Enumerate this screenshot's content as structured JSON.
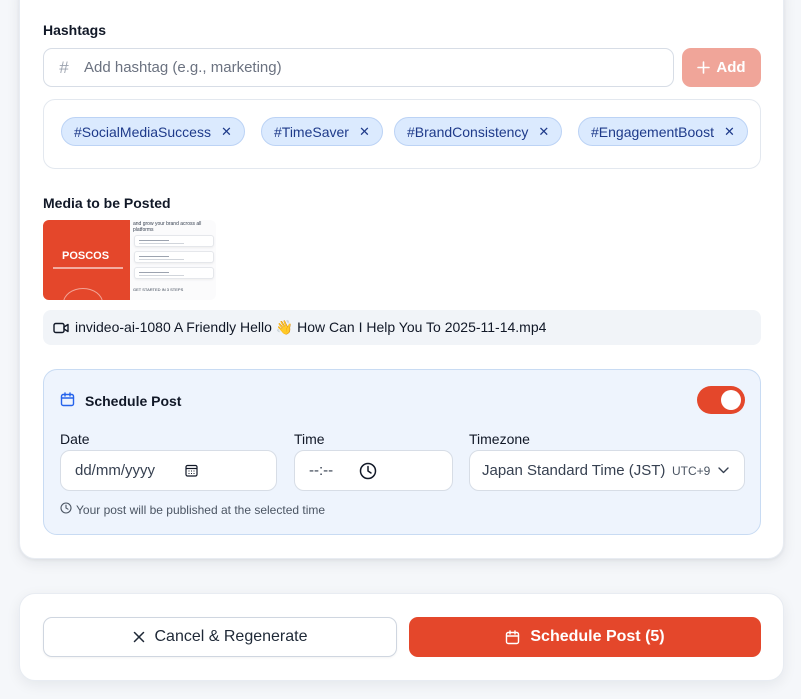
{
  "hashtags": {
    "label": "Hashtags",
    "input_placeholder": "Add hashtag (e.g., marketing)",
    "add_label": "Add",
    "tags": [
      "#SocialMediaSuccess",
      "#TimeSaver",
      "#BrandConsistency",
      "#EngagementBoost"
    ]
  },
  "media": {
    "label": "Media to be Posted",
    "thumbnail": {
      "brand": "POSCOS",
      "headline": "and grow your brand across all platforms",
      "footer": "GET STARTED IN 3 STEPS"
    },
    "file_name": "invideo-ai-1080 A Friendly Hello 👋 How Can I Help You To 2025-11-14.mp4"
  },
  "schedule": {
    "title": "Schedule Post",
    "enabled": true,
    "date_label": "Date",
    "date_placeholder": "dd/mm/yyyy",
    "time_label": "Time",
    "time_placeholder": "--:--",
    "timezone_label": "Timezone",
    "timezone_value": "Japan Standard Time (JST)",
    "timezone_offset": "UTC+9",
    "hint": "Your post will be published at the selected time"
  },
  "footer": {
    "cancel_label": "Cancel & Regenerate",
    "schedule_label": "Schedule Post (5)"
  },
  "colors": {
    "accent": "#e4472b",
    "tag_bg": "#dbeafe",
    "schedule_bg": "#eef4fd"
  }
}
